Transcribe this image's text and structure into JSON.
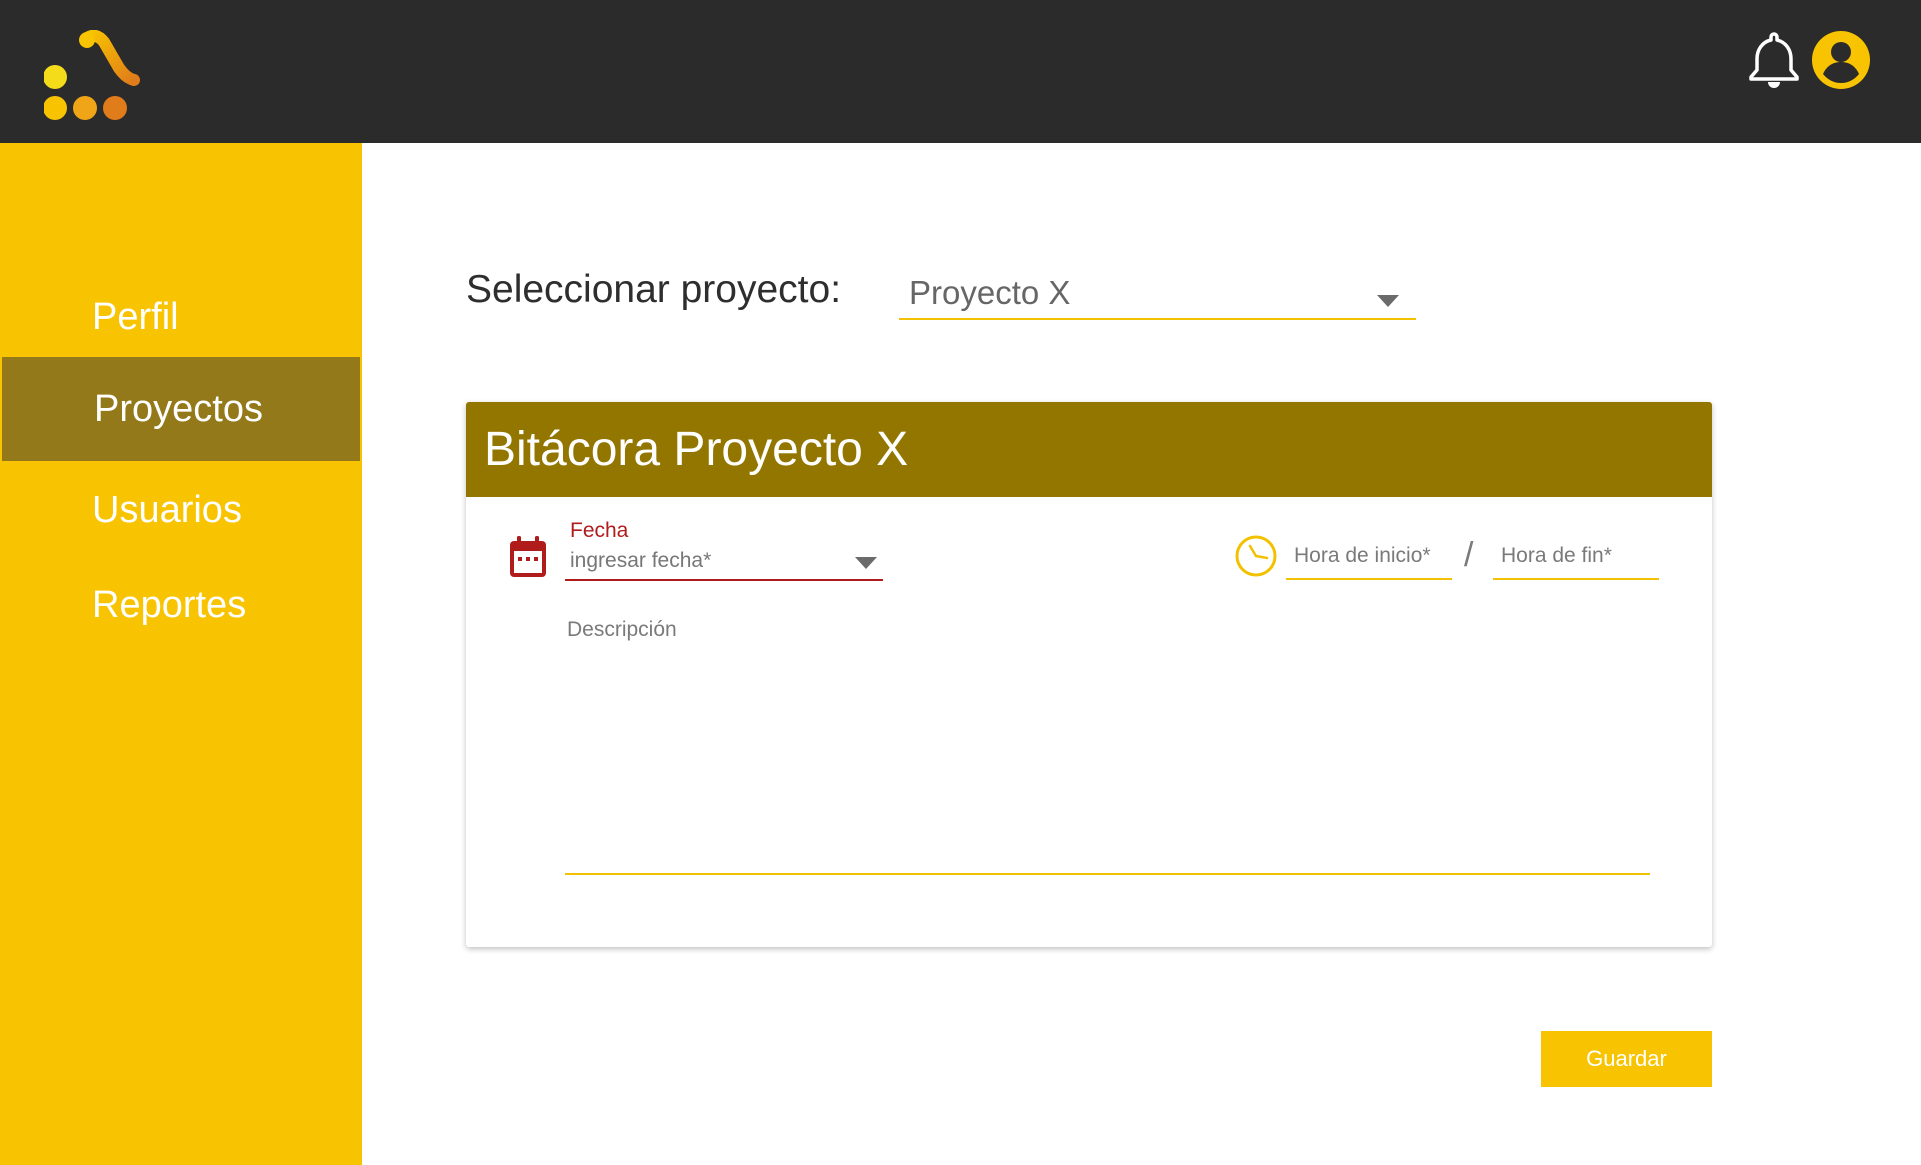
{
  "header": {
    "logo": "app-logo",
    "icons": [
      "bell-icon",
      "account-circle-icon"
    ]
  },
  "sidebar": {
    "items": [
      {
        "label": "Perfil"
      },
      {
        "label": "Proyectos",
        "active": true
      },
      {
        "label": "Usuarios"
      },
      {
        "label": "Reportes"
      }
    ]
  },
  "main": {
    "select_label": "Seleccionar proyecto:",
    "project_select": {
      "value": "Proyecto X"
    }
  },
  "card": {
    "title": "Bitácora Proyecto X",
    "date": {
      "label": "Fecha",
      "placeholder": "ingresar fecha*"
    },
    "time_start": {
      "placeholder": "Hora de inicio*"
    },
    "time_separator": "/",
    "time_end": {
      "placeholder": "Hora de fin*"
    },
    "description": {
      "placeholder": "Descripción"
    }
  },
  "actions": {
    "save_label": "Guardar"
  },
  "colors": {
    "topbar": "#2b2b2b",
    "sidebar": "#f8c300",
    "sidebar_active": "#94791a",
    "card_header": "#937600",
    "accent_red": "#b01c1c",
    "underline": "#f2c200"
  }
}
